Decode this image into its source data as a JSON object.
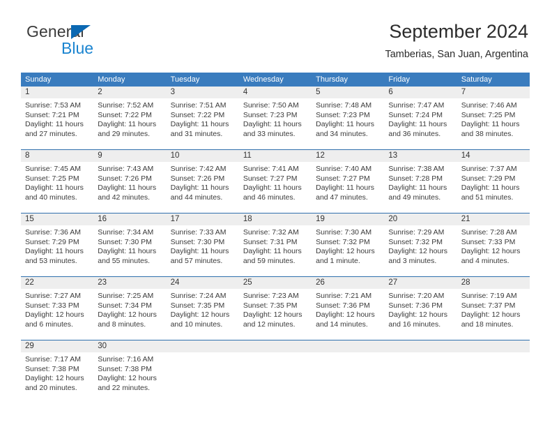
{
  "brand": {
    "word_general": "General",
    "word_blue": "Blue",
    "accent_color": "#1a84d0",
    "triangle_color": "#0b68b2"
  },
  "header": {
    "title": "September 2024",
    "subtitle": "Tamberias, San Juan, Argentina"
  },
  "calendar": {
    "header_background": "#3a7cbe",
    "daynumber_background": "#eeeeee",
    "separator_color": "#2f6fad",
    "day_names": [
      "Sunday",
      "Monday",
      "Tuesday",
      "Wednesday",
      "Thursday",
      "Friday",
      "Saturday"
    ],
    "weeks": [
      {
        "days": [
          {
            "number": "1",
            "sunrise": "Sunrise: 7:53 AM",
            "sunset": "Sunset: 7:21 PM",
            "daylight": "Daylight: 11 hours and 27 minutes."
          },
          {
            "number": "2",
            "sunrise": "Sunrise: 7:52 AM",
            "sunset": "Sunset: 7:22 PM",
            "daylight": "Daylight: 11 hours and 29 minutes."
          },
          {
            "number": "3",
            "sunrise": "Sunrise: 7:51 AM",
            "sunset": "Sunset: 7:22 PM",
            "daylight": "Daylight: 11 hours and 31 minutes."
          },
          {
            "number": "4",
            "sunrise": "Sunrise: 7:50 AM",
            "sunset": "Sunset: 7:23 PM",
            "daylight": "Daylight: 11 hours and 33 minutes."
          },
          {
            "number": "5",
            "sunrise": "Sunrise: 7:48 AM",
            "sunset": "Sunset: 7:23 PM",
            "daylight": "Daylight: 11 hours and 34 minutes."
          },
          {
            "number": "6",
            "sunrise": "Sunrise: 7:47 AM",
            "sunset": "Sunset: 7:24 PM",
            "daylight": "Daylight: 11 hours and 36 minutes."
          },
          {
            "number": "7",
            "sunrise": "Sunrise: 7:46 AM",
            "sunset": "Sunset: 7:25 PM",
            "daylight": "Daylight: 11 hours and 38 minutes."
          }
        ]
      },
      {
        "days": [
          {
            "number": "8",
            "sunrise": "Sunrise: 7:45 AM",
            "sunset": "Sunset: 7:25 PM",
            "daylight": "Daylight: 11 hours and 40 minutes."
          },
          {
            "number": "9",
            "sunrise": "Sunrise: 7:43 AM",
            "sunset": "Sunset: 7:26 PM",
            "daylight": "Daylight: 11 hours and 42 minutes."
          },
          {
            "number": "10",
            "sunrise": "Sunrise: 7:42 AM",
            "sunset": "Sunset: 7:26 PM",
            "daylight": "Daylight: 11 hours and 44 minutes."
          },
          {
            "number": "11",
            "sunrise": "Sunrise: 7:41 AM",
            "sunset": "Sunset: 7:27 PM",
            "daylight": "Daylight: 11 hours and 46 minutes."
          },
          {
            "number": "12",
            "sunrise": "Sunrise: 7:40 AM",
            "sunset": "Sunset: 7:27 PM",
            "daylight": "Daylight: 11 hours and 47 minutes."
          },
          {
            "number": "13",
            "sunrise": "Sunrise: 7:38 AM",
            "sunset": "Sunset: 7:28 PM",
            "daylight": "Daylight: 11 hours and 49 minutes."
          },
          {
            "number": "14",
            "sunrise": "Sunrise: 7:37 AM",
            "sunset": "Sunset: 7:29 PM",
            "daylight": "Daylight: 11 hours and 51 minutes."
          }
        ]
      },
      {
        "days": [
          {
            "number": "15",
            "sunrise": "Sunrise: 7:36 AM",
            "sunset": "Sunset: 7:29 PM",
            "daylight": "Daylight: 11 hours and 53 minutes."
          },
          {
            "number": "16",
            "sunrise": "Sunrise: 7:34 AM",
            "sunset": "Sunset: 7:30 PM",
            "daylight": "Daylight: 11 hours and 55 minutes."
          },
          {
            "number": "17",
            "sunrise": "Sunrise: 7:33 AM",
            "sunset": "Sunset: 7:30 PM",
            "daylight": "Daylight: 11 hours and 57 minutes."
          },
          {
            "number": "18",
            "sunrise": "Sunrise: 7:32 AM",
            "sunset": "Sunset: 7:31 PM",
            "daylight": "Daylight: 11 hours and 59 minutes."
          },
          {
            "number": "19",
            "sunrise": "Sunrise: 7:30 AM",
            "sunset": "Sunset: 7:32 PM",
            "daylight": "Daylight: 12 hours and 1 minute."
          },
          {
            "number": "20",
            "sunrise": "Sunrise: 7:29 AM",
            "sunset": "Sunset: 7:32 PM",
            "daylight": "Daylight: 12 hours and 3 minutes."
          },
          {
            "number": "21",
            "sunrise": "Sunrise: 7:28 AM",
            "sunset": "Sunset: 7:33 PM",
            "daylight": "Daylight: 12 hours and 4 minutes."
          }
        ]
      },
      {
        "days": [
          {
            "number": "22",
            "sunrise": "Sunrise: 7:27 AM",
            "sunset": "Sunset: 7:33 PM",
            "daylight": "Daylight: 12 hours and 6 minutes."
          },
          {
            "number": "23",
            "sunrise": "Sunrise: 7:25 AM",
            "sunset": "Sunset: 7:34 PM",
            "daylight": "Daylight: 12 hours and 8 minutes."
          },
          {
            "number": "24",
            "sunrise": "Sunrise: 7:24 AM",
            "sunset": "Sunset: 7:35 PM",
            "daylight": "Daylight: 12 hours and 10 minutes."
          },
          {
            "number": "25",
            "sunrise": "Sunrise: 7:23 AM",
            "sunset": "Sunset: 7:35 PM",
            "daylight": "Daylight: 12 hours and 12 minutes."
          },
          {
            "number": "26",
            "sunrise": "Sunrise: 7:21 AM",
            "sunset": "Sunset: 7:36 PM",
            "daylight": "Daylight: 12 hours and 14 minutes."
          },
          {
            "number": "27",
            "sunrise": "Sunrise: 7:20 AM",
            "sunset": "Sunset: 7:36 PM",
            "daylight": "Daylight: 12 hours and 16 minutes."
          },
          {
            "number": "28",
            "sunrise": "Sunrise: 7:19 AM",
            "sunset": "Sunset: 7:37 PM",
            "daylight": "Daylight: 12 hours and 18 minutes."
          }
        ]
      },
      {
        "days": [
          {
            "number": "29",
            "sunrise": "Sunrise: 7:17 AM",
            "sunset": "Sunset: 7:38 PM",
            "daylight": "Daylight: 12 hours and 20 minutes."
          },
          {
            "number": "30",
            "sunrise": "Sunrise: 7:16 AM",
            "sunset": "Sunset: 7:38 PM",
            "daylight": "Daylight: 12 hours and 22 minutes."
          },
          {
            "number": "",
            "sunrise": "",
            "sunset": "",
            "daylight": ""
          },
          {
            "number": "",
            "sunrise": "",
            "sunset": "",
            "daylight": ""
          },
          {
            "number": "",
            "sunrise": "",
            "sunset": "",
            "daylight": ""
          },
          {
            "number": "",
            "sunrise": "",
            "sunset": "",
            "daylight": ""
          },
          {
            "number": "",
            "sunrise": "",
            "sunset": "",
            "daylight": ""
          }
        ]
      }
    ]
  }
}
